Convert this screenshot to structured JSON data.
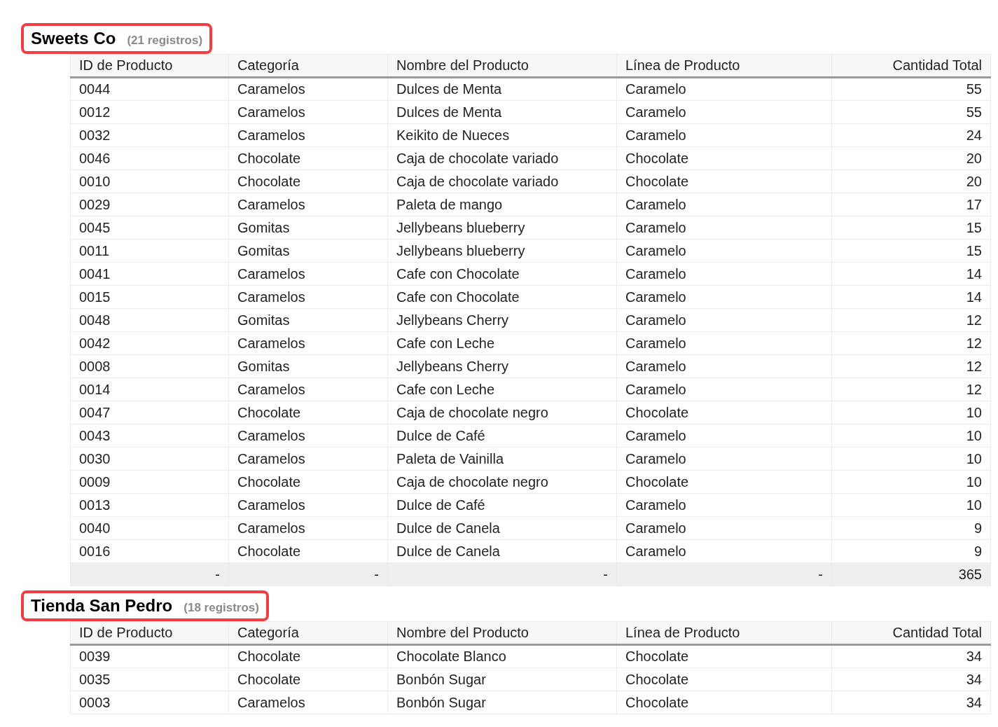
{
  "groups": [
    {
      "title": "Sweets Co",
      "count": "(21 registros)",
      "highlighted": true,
      "columns": [
        "ID de Producto",
        "Categoría",
        "Nombre del Producto",
        "Línea de Producto",
        "Cantidad Total"
      ],
      "rows": [
        [
          "0044",
          "Caramelos",
          "Dulces de Menta",
          "Caramelo",
          "55"
        ],
        [
          "0012",
          "Caramelos",
          "Dulces de Menta",
          "Caramelo",
          "55"
        ],
        [
          "0032",
          "Caramelos",
          "Keikito de Nueces",
          "Caramelo",
          "24"
        ],
        [
          "0046",
          "Chocolate",
          "Caja de chocolate variado",
          "Chocolate",
          "20"
        ],
        [
          "0010",
          "Chocolate",
          "Caja de chocolate variado",
          "Chocolate",
          "20"
        ],
        [
          "0029",
          "Caramelos",
          "Paleta de mango",
          "Caramelo",
          "17"
        ],
        [
          "0045",
          "Gomitas",
          "Jellybeans blueberry",
          "Caramelo",
          "15"
        ],
        [
          "0011",
          "Gomitas",
          "Jellybeans blueberry",
          "Caramelo",
          "15"
        ],
        [
          "0041",
          "Caramelos",
          "Cafe con Chocolate",
          "Caramelo",
          "14"
        ],
        [
          "0015",
          "Caramelos",
          "Cafe con Chocolate",
          "Caramelo",
          "14"
        ],
        [
          "0048",
          "Gomitas",
          "Jellybeans Cherry",
          "Caramelo",
          "12"
        ],
        [
          "0042",
          "Caramelos",
          "Cafe con Leche",
          "Caramelo",
          "12"
        ],
        [
          "0008",
          "Gomitas",
          "Jellybeans Cherry",
          "Caramelo",
          "12"
        ],
        [
          "0014",
          "Caramelos",
          "Cafe con Leche",
          "Caramelo",
          "12"
        ],
        [
          "0047",
          "Chocolate",
          "Caja de chocolate negro",
          "Chocolate",
          "10"
        ],
        [
          "0043",
          "Caramelos",
          "Dulce de Café",
          "Caramelo",
          "10"
        ],
        [
          "0030",
          "Caramelos",
          "Paleta de Vainilla",
          "Caramelo",
          "10"
        ],
        [
          "0009",
          "Chocolate",
          "Caja de chocolate negro",
          "Chocolate",
          "10"
        ],
        [
          "0013",
          "Caramelos",
          "Dulce de Café",
          "Caramelo",
          "10"
        ],
        [
          "0040",
          "Caramelos",
          "Dulce de Canela",
          "Caramelo",
          "9"
        ],
        [
          "0016",
          "Chocolate",
          "Dulce de Canela",
          "Caramelo",
          "9"
        ]
      ],
      "totals": [
        "-",
        "-",
        "-",
        "-",
        "365"
      ]
    },
    {
      "title": "Tienda San Pedro",
      "count": "(18 registros)",
      "highlighted": true,
      "columns": [
        "ID de Producto",
        "Categoría",
        "Nombre del Producto",
        "Línea de Producto",
        "Cantidad Total"
      ],
      "rows": [
        [
          "0039",
          "Chocolate",
          "Chocolate Blanco",
          "Chocolate",
          "34"
        ],
        [
          "0035",
          "Chocolate",
          "Bonbón Sugar",
          "Chocolate",
          "34"
        ],
        [
          "0003",
          "Caramelos",
          "Bonbón Sugar",
          "Chocolate",
          "34"
        ]
      ]
    }
  ]
}
